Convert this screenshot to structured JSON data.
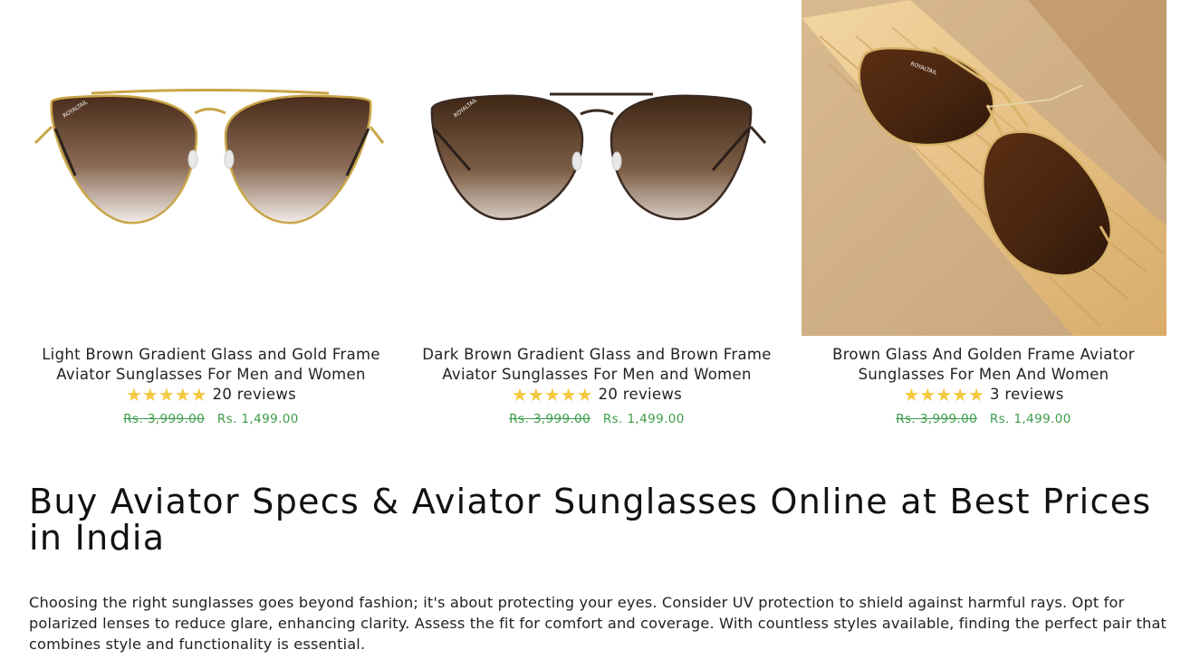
{
  "products": [
    {
      "title": "Light Brown Gradient Glass and Gold Frame Aviator Sunglasses For Men and Women",
      "rating_stars": "★★★★★",
      "rating_value": 5,
      "reviews": "20 reviews",
      "old_price": "Rs. 3,999.00",
      "sale_price": "Rs. 1,499.00",
      "image_icon": "gold-frame-aviator-image",
      "brand_mark": "ROYALTAIL"
    },
    {
      "title": "Dark Brown Gradient Glass and Brown Frame Aviator Sunglasses For Men and Women",
      "rating_stars": "★★★★★",
      "rating_value": 5,
      "reviews": "20 reviews",
      "old_price": "Rs. 3,999.00",
      "sale_price": "Rs. 1,499.00",
      "image_icon": "brown-frame-aviator-image",
      "brand_mark": "ROYALTAIL"
    },
    {
      "title": "Brown Glass And Golden Frame Aviator Sunglasses For Men And Women",
      "rating_stars": "★★★★★",
      "rating_value": 5,
      "reviews": "3 reviews",
      "old_price": "Rs. 3,999.00",
      "sale_price": "Rs. 1,499.00",
      "image_icon": "golden-frame-aviator-lifestyle-image",
      "brand_mark": "ROYALTAIL"
    }
  ],
  "colors": {
    "price_green": "#3c9b4a",
    "star_yellow": "#f5c842",
    "text": "#222222"
  },
  "heading": "Buy Aviator Specs & Aviator Sunglasses Online at Best Prices in India",
  "description": "Choosing the right sunglasses goes beyond fashion; it's about protecting your eyes. Consider UV protection to shield against harmful rays. Opt for polarized lenses to reduce glare, enhancing clarity. Assess the fit for comfort and coverage. With countless styles available, finding the perfect pair that combines style and functionality is essential."
}
